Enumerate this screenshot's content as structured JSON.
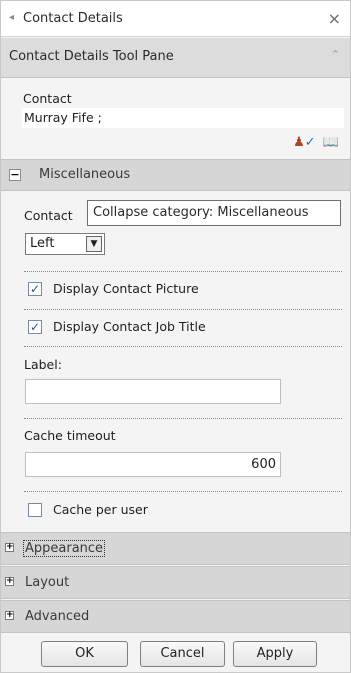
{
  "window": {
    "title": "Contact Details",
    "close_glyph": "×",
    "back_glyph": "◂"
  },
  "toolpane": {
    "header": "Contact Details Tool Pane",
    "collapse_glyph": "⌃"
  },
  "contact": {
    "label": "Contact",
    "value": "Murray Fife ;"
  },
  "misc": {
    "header": "Miscellaneous",
    "expand_glyph": "−",
    "contact_label_partial": "Contact",
    "tooltip": "Collapse category: Miscellaneous",
    "alignment_value": "Left",
    "display_picture_label": "Display Contact Picture",
    "display_picture_checked": true,
    "display_job_title_label": "Display Contact Job Title",
    "display_job_title_checked": true,
    "label_field_label": "Label:",
    "label_field_value": "",
    "cache_timeout_label": "Cache timeout",
    "cache_timeout_value": "600",
    "cache_per_user_label": "Cache per user",
    "cache_per_user_checked": false
  },
  "categories": {
    "appearance": "Appearance",
    "layout": "Layout",
    "advanced": "Advanced",
    "expand_glyph": "+"
  },
  "footer": {
    "ok_label": "OK",
    "cancel_label": "Cancel",
    "apply_label": "Apply"
  },
  "icons": {
    "check_glyph": "✓",
    "dropdown_glyph": "▼"
  }
}
